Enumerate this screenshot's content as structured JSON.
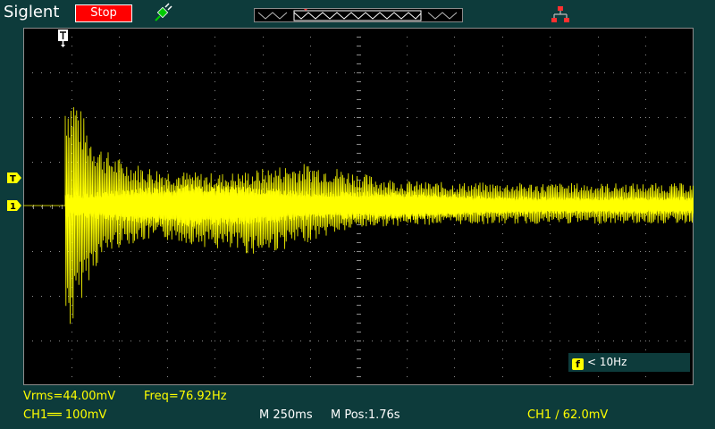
{
  "header": {
    "brand": "Siglent",
    "run_status": "Stop",
    "trigger_time_marker": "T",
    "colors": {
      "stop": "#ff0000",
      "probe": "#00cc00",
      "network": "#ff3030"
    },
    "icons": [
      "probe-icon",
      "network-icon"
    ]
  },
  "screen": {
    "trigger_level_marker": "T",
    "channel1_marker": "1",
    "trace_color": "#ffff00",
    "grid_divisions": {
      "x": 14,
      "y": 8
    }
  },
  "freq_filter": {
    "icon_letter": "f",
    "text": "< 10Hz"
  },
  "measurements": {
    "vrms": "Vrms=44.00mV",
    "freq": "Freq=76.92Hz"
  },
  "status": {
    "ch1_scale": "CH1══ 100mV",
    "timebase": "M 250ms",
    "mpos": "M Pos:1.76s",
    "trigger": "CH1 ∕ 62.0mV"
  }
}
